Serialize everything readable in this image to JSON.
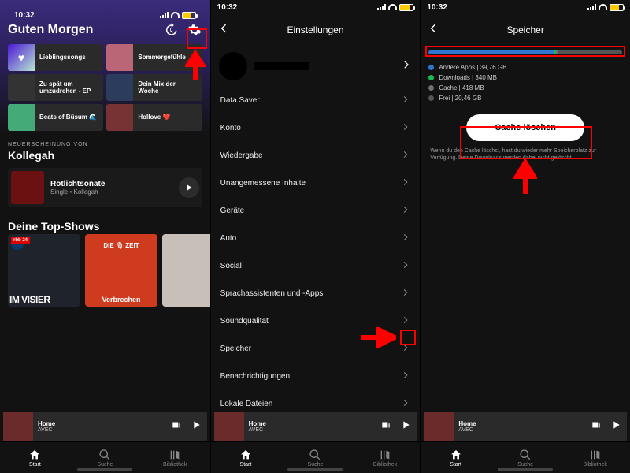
{
  "status": {
    "time": "10:32"
  },
  "home": {
    "greeting": "Guten Morgen",
    "tiles": [
      {
        "label": "Lieblingssongs"
      },
      {
        "label": "Sommergefühle"
      },
      {
        "label": "Zu spät um umzudrehen - EP"
      },
      {
        "label": "Dein Mix der Woche"
      },
      {
        "label": "Beats of Büsum 🌊"
      },
      {
        "label": "Hollove ❤️"
      }
    ],
    "release": {
      "eyebrow": "NEUERSCHEINUNG VON",
      "artist": "Kollegah",
      "track": "Rotlichtsonate",
      "sub": "Single • Kollegah"
    },
    "top_shows_title": "Deine Top-Shows",
    "shows": [
      {
        "badge": "rbb 24",
        "footer": "IM VISIER"
      },
      {
        "badge": "DIE 🎙 ZEIT",
        "footer": "Verbrechen"
      },
      {
        "badge": "",
        "footer": ""
      }
    ]
  },
  "nowplaying": {
    "title": "Home",
    "artist": "AVEC"
  },
  "nav": {
    "start": "Start",
    "suche": "Suche",
    "bibliothek": "Bibliothek"
  },
  "settings": {
    "header": "Einstellungen",
    "items": [
      "Data Saver",
      "Konto",
      "Wiedergabe",
      "Unangemessene Inhalte",
      "Geräte",
      "Auto",
      "Social",
      "Sprachassistenten und -Apps",
      "Soundqualität",
      "Speicher",
      "Benachrichtigungen",
      "Lokale Dateien"
    ]
  },
  "storage": {
    "header": "Speicher",
    "legend": [
      {
        "label": "Andere Apps | 39,76 GB",
        "color": "d-blue"
      },
      {
        "label": "Downloads | 340 MB",
        "color": "d-green"
      },
      {
        "label": "Cache | 418 MB",
        "color": "d-grey"
      },
      {
        "label": "Frei | 20,46 GB",
        "color": "d-dgrey"
      }
    ],
    "segments_pct": [
      65,
      1,
      1
    ],
    "clear_cache": "Cache löschen",
    "hint": "Wenn du den Cache löschst, hast du wieder mehr Speicherplatz zur Verfügung. Deine Downloads werden dabei nicht gelöscht."
  }
}
